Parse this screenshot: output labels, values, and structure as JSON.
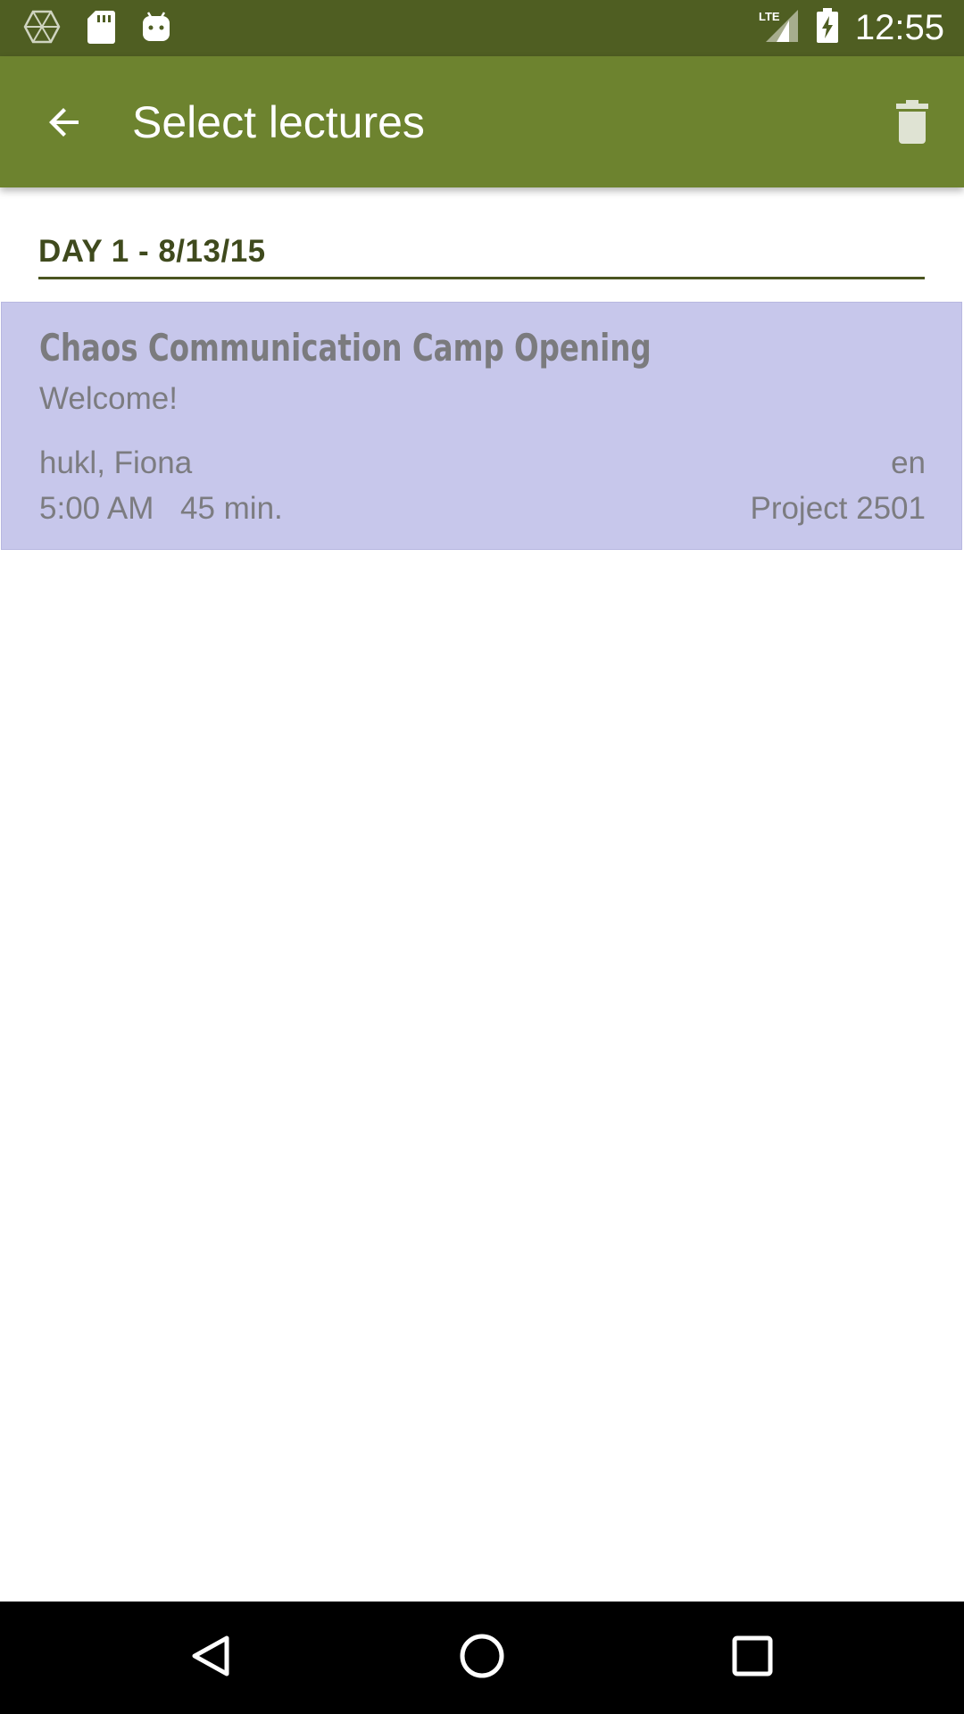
{
  "status_bar": {
    "time": "12:55",
    "network": "LTE",
    "icons": [
      "network-hub-icon",
      "sd-card-icon",
      "android-icon",
      "lte-signal-icon",
      "battery-charging-icon"
    ]
  },
  "app_bar": {
    "title": "Select lectures",
    "back_icon": "arrow-back-icon",
    "action_icon": "delete-icon",
    "background_color": "#6d832f"
  },
  "day_header": {
    "label": "DAY 1 - 8/13/15"
  },
  "lectures": [
    {
      "title": "Chaos Communication Camp Opening",
      "subtitle": "Welcome!",
      "speakers": "hukl, Fiona",
      "language": "en",
      "time": "5:00 AM",
      "duration": "45 min.",
      "room": "Project 2501",
      "selected": true,
      "highlight_color": "#c7c7eb"
    }
  ],
  "nav_bar": {
    "icons": [
      "nav-back-icon",
      "nav-home-icon",
      "nav-recents-icon"
    ]
  }
}
